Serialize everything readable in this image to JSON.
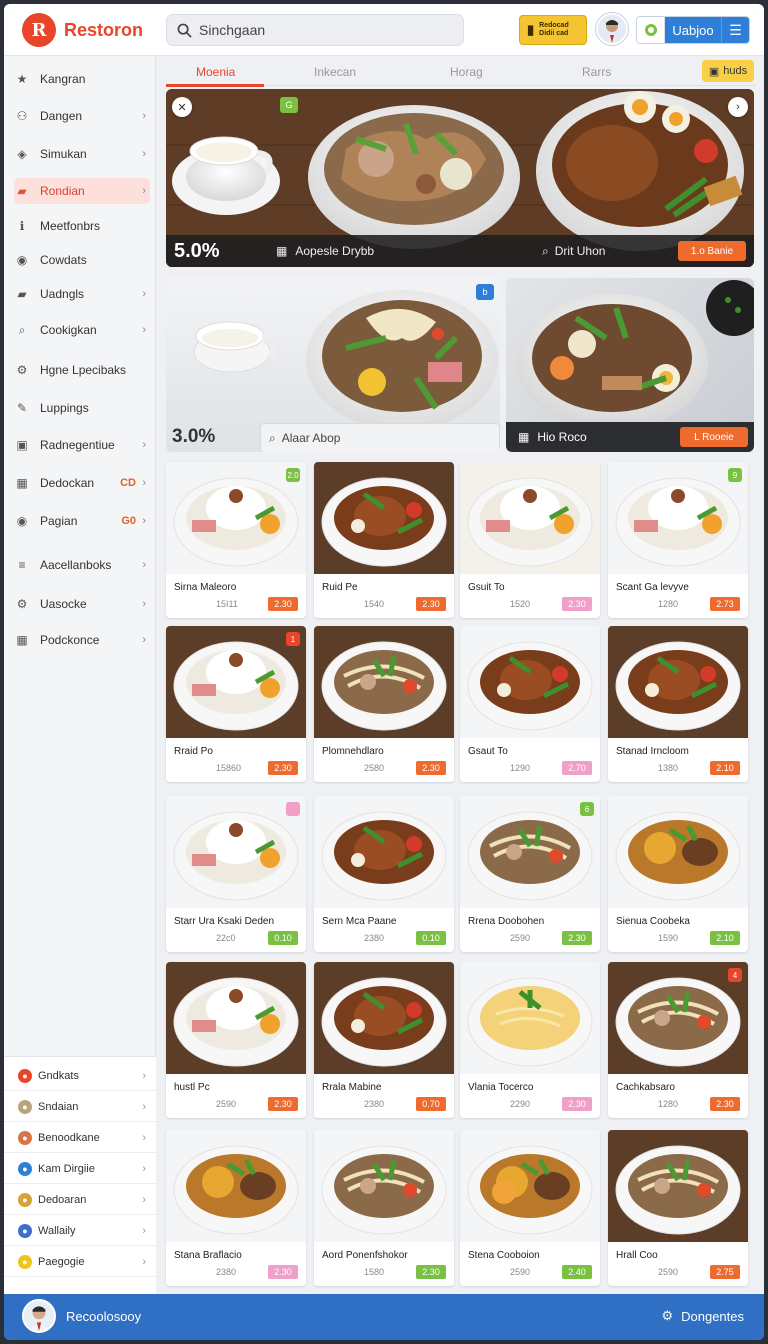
{
  "app": {
    "name": "Restoron"
  },
  "search": {
    "value": "Sinchgaan"
  },
  "header": {
    "badge_line1": "Redocad",
    "badge_line2": "Didii cad",
    "toggle_label": "Uabjoo",
    "menu_icon": "menu-icon"
  },
  "sidebar": {
    "items": [
      {
        "label": "Kangran",
        "icon": "star-icon",
        "chevron": false
      },
      {
        "label": "Dangen",
        "icon": "users-icon",
        "chevron": true
      },
      {
        "label": "Simukan",
        "icon": "tag-icon",
        "chevron": true
      },
      {
        "label": "Rondian",
        "icon": "bag-icon",
        "chevron": true,
        "active": true
      },
      {
        "label": "Meetfonbrs",
        "icon": "info-icon",
        "chevron": false
      },
      {
        "label": "Cowdats",
        "icon": "pin-icon",
        "chevron": false
      },
      {
        "label": "Uadngls",
        "icon": "bag-icon",
        "chevron": true
      },
      {
        "label": "Cookigkan",
        "icon": "search-icon",
        "chevron": true
      },
      {
        "label": "Hgne Lpecibaks",
        "icon": "gear-icon",
        "chevron": false
      },
      {
        "label": "Luppings",
        "icon": "wrench-icon",
        "chevron": false
      },
      {
        "label": "Radnegentiue",
        "icon": "box-icon",
        "chevron": true
      },
      {
        "label": "Dedockan",
        "icon": "grid-icon",
        "chevron": true,
        "tag": "CD",
        "tag_color": "#e0612a"
      },
      {
        "label": "Pagian",
        "icon": "pin-icon",
        "chevron": true,
        "tag": "G0",
        "tag_color": "#e0612a"
      },
      {
        "label": "Aacellanboks",
        "icon": "list-icon",
        "chevron": true
      },
      {
        "label": "Uasocke",
        "icon": "gear-icon",
        "chevron": true
      },
      {
        "label": "Podckonce",
        "icon": "grid-icon",
        "chevron": true
      }
    ],
    "bottom": [
      {
        "label": "Gndkats",
        "color": "#e8452b"
      },
      {
        "label": "Sndaian",
        "color": "#b9a57a"
      },
      {
        "label": "Benoodkane",
        "color": "#d9734a"
      },
      {
        "label": "Kam Dirgiie",
        "color": "#2f7fd8"
      },
      {
        "label": "Dedoaran",
        "color": "#d9a03c"
      },
      {
        "label": "Wallaily",
        "color": "#3d6fd0"
      },
      {
        "label": "Paegogie",
        "color": "#f0c419"
      }
    ]
  },
  "tabs": [
    {
      "label": "Moenia",
      "active": true
    },
    {
      "label": "Inkecan"
    },
    {
      "label": "Horag"
    },
    {
      "label": "Rarrs"
    }
  ],
  "tab_badge": "huds",
  "hero": {
    "big": "5.0%",
    "label1": "Aopesle Drybb",
    "label2": "Drit Uhon",
    "button": "1.o Banie",
    "tag": "G"
  },
  "promo_a": {
    "big": "3.0%",
    "search": "Alaar Abop"
  },
  "promo_b": {
    "label": "Hio Roco",
    "button": "L Rooeie",
    "tag": "b"
  },
  "cards": [
    {
      "name": "Sirna Maleoro",
      "num": "15I11",
      "price": "2.30",
      "price_color": "#ee6a2d",
      "corner": "2.0",
      "corner_color": "#7ac142",
      "scene": "rice-light"
    },
    {
      "name": "Ruid Pe",
      "num": "1540",
      "price": "2.30",
      "price_color": "#ee6a2d",
      "scene": "stew-dark"
    },
    {
      "name": "Gsuit To",
      "num": "1520",
      "price": "2.30",
      "price_color": "#f0a0c8",
      "scene": "rice-basket"
    },
    {
      "name": "Scant Ga levyve",
      "num": "1280",
      "price": "2.73",
      "price_color": "#ee6a2d",
      "corner": "9",
      "corner_color": "#7ac142",
      "scene": "rice-light"
    },
    {
      "name": "Rraid Po",
      "num": "15860",
      "price": "2.30",
      "price_color": "#ee6a2d",
      "corner": "1",
      "corner_color": "#e8452b",
      "scene": "rice-dark"
    },
    {
      "name": "Plomnehdlaro",
      "num": "2580",
      "price": "2.30",
      "price_color": "#ee6a2d",
      "scene": "noodle-dark"
    },
    {
      "name": "Gsaut To",
      "num": "1290",
      "price": "2.70",
      "price_color": "#f0a0c8",
      "scene": "stew-light"
    },
    {
      "name": "Stanad Irncloom",
      "num": "1380",
      "price": "2.10",
      "price_color": "#ee6a2d",
      "scene": "stew-dark"
    },
    {
      "name": "Starr Ura Ksaki Deden",
      "num": "22c0",
      "price": "0.10",
      "price_color": "#7ac142",
      "corner": "",
      "corner_color": "#f0a0c8",
      "scene": "rice-light"
    },
    {
      "name": "Sern Mca Paane",
      "num": "2380",
      "price": "0.10",
      "price_color": "#7ac142",
      "scene": "stew-light"
    },
    {
      "name": "Rrena Doobohen",
      "num": "2590",
      "price": "2.30",
      "price_color": "#7ac142",
      "corner": "6",
      "corner_color": "#7ac142",
      "scene": "noodle-light"
    },
    {
      "name": "Sienua Coobeka",
      "num": "1590",
      "price": "2.10",
      "price_color": "#7ac142",
      "scene": "curry-light"
    },
    {
      "name": "hustl Pc",
      "num": "2590",
      "price": "2.30",
      "price_color": "#ee6a2d",
      "scene": "rice-dark"
    },
    {
      "name": "Rrala Mabine",
      "num": "2380",
      "price": "0.70",
      "price_color": "#ee6a2d",
      "scene": "stew-dark"
    },
    {
      "name": "Vlania Tocerco",
      "num": "2290",
      "price": "2.30",
      "price_color": "#f0a0c8",
      "scene": "soup-light"
    },
    {
      "name": "Cachkabsaro",
      "num": "1280",
      "price": "2.30",
      "price_color": "#ee6a2d",
      "corner": "4",
      "corner_color": "#e8452b",
      "scene": "noodle-dark"
    },
    {
      "name": "Stana Braflacio",
      "num": "2380",
      "price": "2.30",
      "price_color": "#f0a0c8",
      "scene": "curry-light"
    },
    {
      "name": "Aord Ponenfshokor",
      "num": "1580",
      "price": "2.30",
      "price_color": "#7ac142",
      "scene": "noodle-light"
    },
    {
      "name": "Stena Cooboion",
      "num": "2590",
      "price": "2.40",
      "price_color": "#7ac142",
      "scene": "curry-sauce"
    },
    {
      "name": "Hrall Coo",
      "num": "2590",
      "price": "2.75",
      "price_color": "#ee6a2d",
      "scene": "noodle-dark"
    }
  ],
  "footer": {
    "name": "Recoolosooy",
    "right_label": "Dongentes"
  }
}
